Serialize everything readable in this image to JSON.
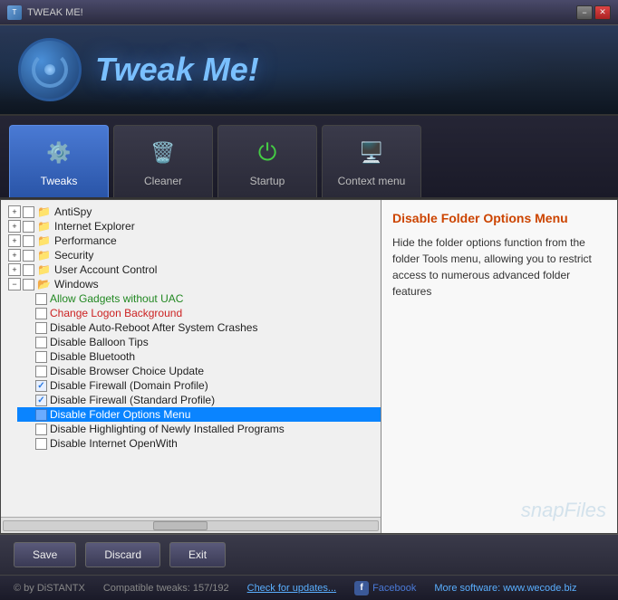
{
  "titleBar": {
    "title": "TWEAK ME!",
    "minBtn": "−",
    "closeBtn": "✕"
  },
  "header": {
    "appName": "Tweak Me!"
  },
  "tabs": [
    {
      "id": "tweaks",
      "label": "Tweaks",
      "active": true,
      "icon": "⚙"
    },
    {
      "id": "cleaner",
      "label": "Cleaner",
      "active": false,
      "icon": "🗑"
    },
    {
      "id": "startup",
      "label": "Startup",
      "active": false,
      "icon": "⏻"
    },
    {
      "id": "context",
      "label": "Context menu",
      "active": false,
      "icon": "🖥"
    }
  ],
  "treeItems": [
    {
      "id": "antispy",
      "label": "AntiSpy",
      "indent": 1,
      "hasExpand": true,
      "hasCheckbox": true,
      "checked": false,
      "color": "normal"
    },
    {
      "id": "ie",
      "label": "Internet Explorer",
      "indent": 1,
      "hasExpand": true,
      "hasCheckbox": true,
      "checked": false,
      "color": "normal"
    },
    {
      "id": "performance",
      "label": "Performance",
      "indent": 1,
      "hasExpand": true,
      "hasCheckbox": true,
      "checked": false,
      "color": "normal"
    },
    {
      "id": "security",
      "label": "Security",
      "indent": 1,
      "hasExpand": true,
      "hasCheckbox": true,
      "checked": false,
      "color": "normal"
    },
    {
      "id": "uac",
      "label": "User Account Control",
      "indent": 1,
      "hasExpand": true,
      "hasCheckbox": true,
      "checked": false,
      "color": "normal"
    },
    {
      "id": "windows",
      "label": "Windows",
      "indent": 1,
      "hasExpand": true,
      "expanded": true,
      "hasCheckbox": true,
      "checked": false,
      "color": "normal"
    },
    {
      "id": "allow-gadgets",
      "label": "Allow Gadgets without UAC",
      "indent": 2,
      "hasCheckbox": true,
      "checked": false,
      "color": "green"
    },
    {
      "id": "change-logon",
      "label": "Change Logon Background",
      "indent": 2,
      "hasCheckbox": true,
      "checked": false,
      "color": "red"
    },
    {
      "id": "disable-autoreboot",
      "label": "Disable Auto-Reboot After System Crashes",
      "indent": 2,
      "hasCheckbox": true,
      "checked": false,
      "color": "normal"
    },
    {
      "id": "disable-balloon",
      "label": "Disable Balloon Tips",
      "indent": 2,
      "hasCheckbox": true,
      "checked": false,
      "color": "normal"
    },
    {
      "id": "disable-bluetooth",
      "label": "Disable Bluetooth",
      "indent": 2,
      "hasCheckbox": true,
      "checked": false,
      "color": "normal"
    },
    {
      "id": "disable-browser-choice",
      "label": "Disable Browser Choice Update",
      "indent": 2,
      "hasCheckbox": true,
      "checked": false,
      "color": "normal"
    },
    {
      "id": "disable-firewall-domain",
      "label": "Disable Firewall (Domain Profile)",
      "indent": 2,
      "hasCheckbox": true,
      "checked": true,
      "color": "normal"
    },
    {
      "id": "disable-firewall-standard",
      "label": "Disable Firewall (Standard Profile)",
      "indent": 2,
      "hasCheckbox": true,
      "checked": true,
      "color": "normal"
    },
    {
      "id": "disable-folder-options",
      "label": "Disable Folder Options Menu",
      "indent": 2,
      "hasCheckbox": true,
      "checked": false,
      "color": "normal",
      "selected": true
    },
    {
      "id": "disable-highlighting",
      "label": "Disable Highlighting of Newly Installed Programs",
      "indent": 2,
      "hasCheckbox": true,
      "checked": false,
      "color": "normal"
    },
    {
      "id": "disable-internet-openwith",
      "label": "Disable Internet OpenWith",
      "indent": 2,
      "hasCheckbox": true,
      "checked": false,
      "color": "normal"
    }
  ],
  "rightPanel": {
    "title": "Disable Folder Options Menu",
    "description": "Hide the folder options function from the folder Tools menu, allowing you to restrict access to numerous advanced folder features",
    "watermark": "snapFiles"
  },
  "toolbar": {
    "saveLabel": "Save",
    "discardLabel": "Discard",
    "exitLabel": "Exit"
  },
  "statusBar": {
    "copyright": "© by DiSTANTX",
    "compatible": "Compatible tweaks: 157/192",
    "checkUpdates": "Check for updates...",
    "facebook": "Facebook",
    "moreSoftware": "More software: www.wecode.biz"
  }
}
